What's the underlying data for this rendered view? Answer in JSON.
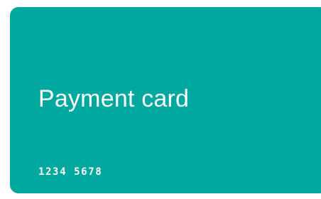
{
  "card": {
    "title": "Payment card",
    "number": "1234 5678"
  },
  "colors": {
    "card_background": "#00A8A0",
    "text": "#FFFFFF",
    "page_background": "#FFFFFF"
  }
}
